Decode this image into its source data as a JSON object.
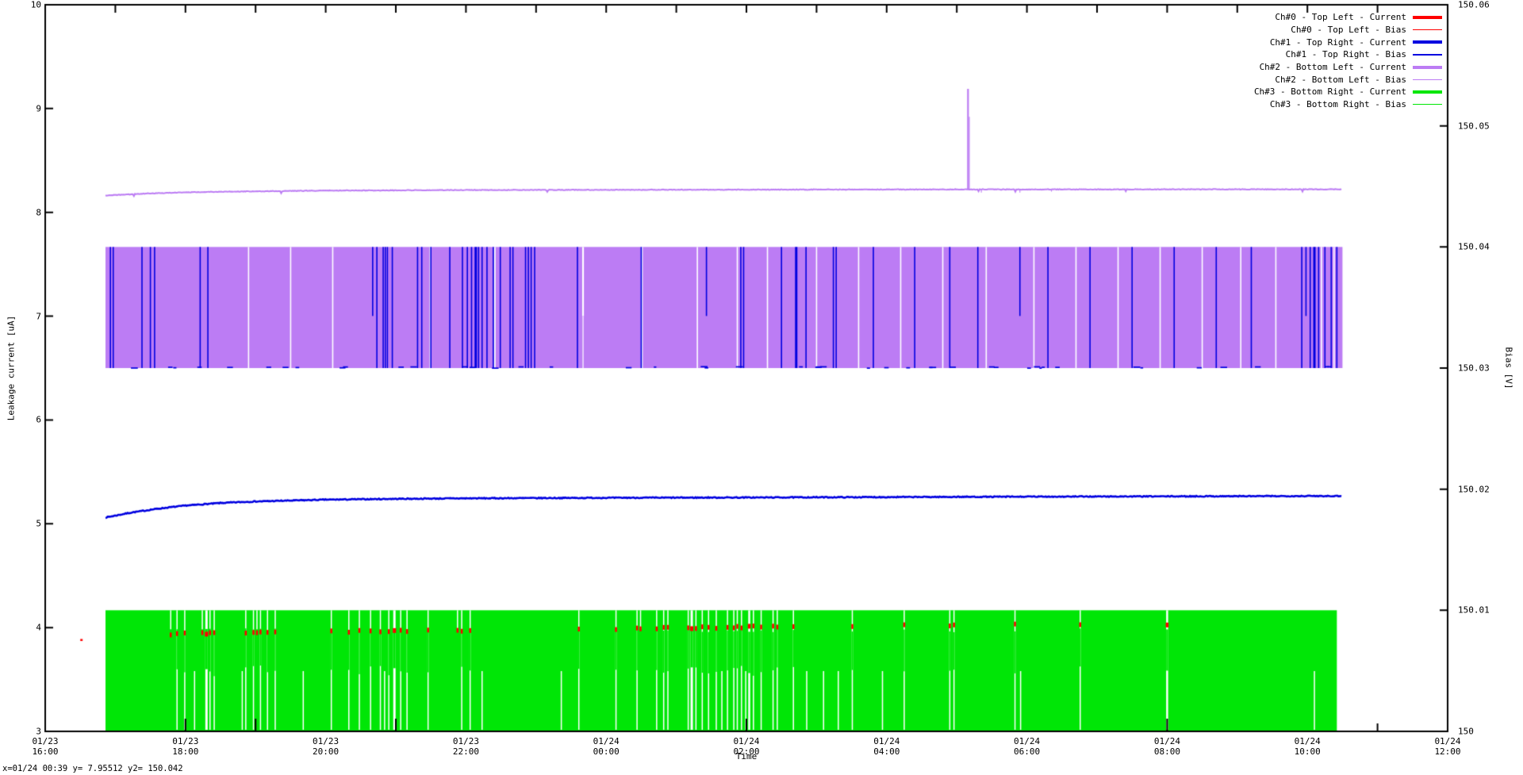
{
  "status_line": "x=01/24 00:39 y= 7.95512 y2= 150.042",
  "colors": {
    "red": "#ff0000",
    "blue": "#0000e0",
    "purple": "#bc7cf4",
    "green": "#00e606",
    "black": "#000000",
    "background": "#ffffff"
  },
  "legend": {
    "entries": [
      {
        "label": "Ch#0 - Top Left - Current",
        "color": "#ff0000",
        "thick": true
      },
      {
        "label": "Ch#0 - Top Left - Bias",
        "color": "#ff0000",
        "thick": false
      },
      {
        "label": "Ch#1 - Top Right - Current",
        "color": "#0000e0",
        "thick": true
      },
      {
        "label": "Ch#1 - Top Right - Bias",
        "color": "#0000e0",
        "thick": false
      },
      {
        "label": "Ch#2 - Bottom Left - Current",
        "color": "#bc7cf4",
        "thick": true
      },
      {
        "label": "Ch#2 - Bottom Left - Bias",
        "color": "#bc7cf4",
        "thick": false
      },
      {
        "label": "Ch#3 - Bottom Right - Current",
        "color": "#00e606",
        "thick": true
      },
      {
        "label": "Ch#3 - Bottom Right - Bias",
        "color": "#00e606",
        "thick": false
      }
    ]
  },
  "chart_data": {
    "type": "line",
    "title": "",
    "xlabel": "Time",
    "ylabel": "Leakage current [uA]",
    "y2label": "Bias [V]",
    "x_range": {
      "start": "01/23 16:00",
      "end": "01/24 12:00",
      "hours": 20
    },
    "ylim": [
      3,
      10
    ],
    "y2lim": [
      150.0,
      150.06
    ],
    "grid": false,
    "legend_position": "top-right-inside",
    "x_ticks": [
      {
        "date": "01/23",
        "time": "16:00"
      },
      {
        "date": "01/23",
        "time": "18:00"
      },
      {
        "date": "01/23",
        "time": "20:00"
      },
      {
        "date": "01/23",
        "time": "22:00"
      },
      {
        "date": "01/24",
        "time": "00:00"
      },
      {
        "date": "01/24",
        "time": "02:00"
      },
      {
        "date": "01/24",
        "time": "04:00"
      },
      {
        "date": "01/24",
        "time": "06:00"
      },
      {
        "date": "01/24",
        "time": "08:00"
      },
      {
        "date": "01/24",
        "time": "10:00"
      },
      {
        "date": "01/24",
        "time": "12:00"
      }
    ],
    "y_ticks": [
      "3",
      "4",
      "5",
      "6",
      "7",
      "8",
      "9",
      "10"
    ],
    "y2_ticks": [
      "150",
      "150.01",
      "150.02",
      "150.03",
      "150.04",
      "150.05",
      "150.06"
    ],
    "minor_x_tick_every_hours": 1,
    "data_span_hours": [
      0.86,
      18.5
    ],
    "visible_bottom_tick_stub_hours": [
      2,
      3,
      5,
      10,
      16
    ],
    "stray_red_dash": {
      "hour": 0.5,
      "value": 3.89
    },
    "series": [
      {
        "name": "Ch#0 - Top Left - Current",
        "axis": "y",
        "width": "thick",
        "color": "#ff0000",
        "kind": "noisy-line-hidden-behind-band",
        "keypoints": [
          [
            0.86,
            3.93
          ],
          [
            4,
            3.96
          ],
          [
            8,
            3.99
          ],
          [
            12,
            4.02
          ],
          [
            16,
            4.03
          ],
          [
            18.5,
            4.04
          ]
        ],
        "noise": 0.02,
        "note": "visible only as short red dashes inside white gaps of the green bias band"
      },
      {
        "name": "Ch#0 - Top Left - Bias",
        "axis": "y2",
        "width": "thin",
        "color": "#ff0000",
        "kind": "quantized-hidden",
        "levels": [
          150.0,
          150.01
        ],
        "note": "fully hidden behind Ch#3 bias band"
      },
      {
        "name": "Ch#1 - Top Right - Current",
        "axis": "y",
        "width": "thick",
        "color": "#0000e0",
        "kind": "smooth-line",
        "keypoints": [
          [
            0.86,
            5.06
          ],
          [
            1.2,
            5.105
          ],
          [
            1.6,
            5.145
          ],
          [
            2,
            5.175
          ],
          [
            2.5,
            5.2
          ],
          [
            3,
            5.215
          ],
          [
            4,
            5.232
          ],
          [
            5,
            5.24
          ],
          [
            6,
            5.245
          ],
          [
            8,
            5.25
          ],
          [
            10,
            5.253
          ],
          [
            12,
            5.257
          ],
          [
            14,
            5.261
          ],
          [
            16,
            5.264
          ],
          [
            18.5,
            5.268
          ]
        ],
        "noise": 0.009
      },
      {
        "name": "Ch#1 - Top Right - Bias",
        "axis": "y2",
        "width": "thin",
        "color": "#0000e0",
        "kind": "quantized-toggle-lines",
        "levels": [
          150.03,
          150.04
        ],
        "toggle_hours": [
          0.93,
          0.97,
          1.38,
          1.5,
          1.56,
          2.21,
          2.32,
          4.67,
          4.73,
          4.82,
          4.85,
          4.88,
          4.95,
          5.31,
          5.37,
          5.5,
          5.77,
          5.95,
          6.02,
          6.08,
          6.14,
          6.18,
          6.23,
          6.3,
          6.39,
          6.49,
          6.63,
          6.67,
          6.85,
          6.89,
          6.93,
          6.98,
          7.59,
          8.5,
          9.43,
          9.92,
          9.96,
          10.5,
          10.71,
          10.85,
          11.24,
          11.28,
          11.81,
          12.4,
          12.9,
          13.3,
          13.9,
          14.3,
          14.9,
          15.5,
          16.1,
          16.7,
          17.2,
          17.92,
          17.98,
          18.04,
          18.1,
          18.16,
          18.25,
          18.34,
          18.42
        ],
        "partial_toggle_hours": [
          4.67,
          9.43,
          13.9,
          17.98
        ],
        "thick_toggle_hours": [
          6.14,
          10.71,
          18.1
        ],
        "bottom_dash_count": 46
      },
      {
        "name": "Ch#2 - Bottom Left - Current",
        "axis": "y",
        "width": "thick",
        "color": "#bc7cf4",
        "kind": "smooth-line-with-spike",
        "keypoints": [
          [
            0.86,
            8.163
          ],
          [
            1.5,
            8.183
          ],
          [
            2,
            8.193
          ],
          [
            3,
            8.203
          ],
          [
            4,
            8.21
          ],
          [
            6,
            8.215
          ],
          [
            9,
            8.218
          ],
          [
            13,
            8.221
          ],
          [
            18.5,
            8.222
          ]
        ],
        "noise": 0.006,
        "spike": {
          "hour": 13.16,
          "peak": 9.19,
          "shoulder": 8.92
        },
        "post_spike_dips": [
          [
            13.35,
            8.19
          ],
          [
            13.9,
            8.19
          ],
          [
            14.35,
            8.2
          ]
        ]
      },
      {
        "name": "Ch#2 - Bottom Left - Bias",
        "axis": "y2",
        "width": "thin",
        "color": "#bc7cf4",
        "kind": "quantized-band",
        "levels": [
          150.03,
          150.04
        ],
        "gaps": [
          [
            2.9,
            0
          ],
          [
            3.5,
            0
          ],
          [
            4.1,
            0
          ],
          [
            5.49,
            0
          ],
          [
            6.41,
            0,
            2.2
          ],
          [
            7.67,
            1,
            2.2
          ],
          [
            8.51,
            0,
            2.2
          ],
          [
            9.3,
            0
          ],
          [
            9.87,
            0
          ],
          [
            10.3,
            0
          ],
          [
            11.0,
            0
          ],
          [
            11.6,
            0
          ],
          [
            12.2,
            0
          ],
          [
            12.8,
            0
          ],
          [
            13.42,
            0
          ],
          [
            14.1,
            0
          ],
          [
            14.7,
            0
          ],
          [
            15.3,
            0
          ],
          [
            15.9,
            0
          ],
          [
            16.5,
            0
          ],
          [
            17.05,
            0
          ],
          [
            17.55,
            0
          ],
          [
            18.2,
            0
          ],
          [
            18.38,
            0
          ]
        ]
      },
      {
        "name": "Ch#3 - Bottom Right - Current",
        "axis": "y",
        "width": "thick",
        "color": "#00e606",
        "kind": "noisy-line-hidden-in-band",
        "keypoints": [
          [
            0.86,
            3.78
          ],
          [
            18.5,
            3.8
          ]
        ],
        "noise": 0.15,
        "note": "visible as green mid segments inside white gaps of the green bias band"
      },
      {
        "name": "Ch#3 - Bottom Right - Bias",
        "axis": "y2",
        "width": "thin",
        "color": "#00e606",
        "kind": "quantized-band",
        "levels": [
          150.0,
          150.01
        ],
        "end_hour": 18.42,
        "red_dash_in_gaps": true,
        "gaps": [
          [
            1.79,
            1
          ],
          [
            1.88,
            0
          ],
          [
            1.99,
            0
          ],
          [
            2.13,
            2
          ],
          [
            2.24,
            1
          ],
          [
            2.3,
            0,
            3
          ],
          [
            2.35,
            0
          ],
          [
            2.41,
            0
          ],
          [
            2.81,
            2
          ],
          [
            2.86,
            0
          ],
          [
            2.97,
            0
          ],
          [
            3.02,
            1
          ],
          [
            3.07,
            0
          ],
          [
            3.17,
            0
          ],
          [
            3.28,
            0
          ],
          [
            3.68,
            2
          ],
          [
            4.08,
            0
          ],
          [
            4.33,
            0
          ],
          [
            4.48,
            0
          ],
          [
            4.64,
            0
          ],
          [
            4.78,
            0
          ],
          [
            4.84,
            2
          ],
          [
            4.9,
            0
          ],
          [
            4.98,
            0,
            3
          ],
          [
            5.07,
            0
          ],
          [
            5.16,
            0
          ],
          [
            5.46,
            0
          ],
          [
            5.88,
            1
          ],
          [
            5.94,
            0
          ],
          [
            6.06,
            0
          ],
          [
            6.23,
            2
          ],
          [
            7.36,
            2
          ],
          [
            7.61,
            0
          ],
          [
            8.14,
            0
          ],
          [
            8.44,
            0
          ],
          [
            8.49,
            1
          ],
          [
            8.72,
            0
          ],
          [
            8.82,
            0
          ],
          [
            8.88,
            0
          ],
          [
            9.17,
            0
          ],
          [
            9.22,
            0,
            3
          ],
          [
            9.28,
            0
          ],
          [
            9.37,
            0
          ],
          [
            9.46,
            0
          ],
          [
            9.57,
            0
          ],
          [
            9.65,
            2
          ],
          [
            9.73,
            0
          ],
          [
            9.82,
            0
          ],
          [
            9.87,
            0
          ],
          [
            9.93,
            0
          ],
          [
            9.99,
            2
          ],
          [
            10.04,
            0,
            2.5
          ],
          [
            10.1,
            0
          ],
          [
            10.21,
            0
          ],
          [
            10.38,
            0
          ],
          [
            10.44,
            0
          ],
          [
            10.67,
            0
          ],
          [
            10.86,
            2
          ],
          [
            11.1,
            2
          ],
          [
            11.31,
            2
          ],
          [
            11.51,
            0
          ],
          [
            11.94,
            2
          ],
          [
            12.25,
            0
          ],
          [
            12.9,
            0
          ],
          [
            12.96,
            0
          ],
          [
            13.83,
            0
          ],
          [
            13.91,
            2
          ],
          [
            14.76,
            0
          ],
          [
            16.0,
            0,
            2.5
          ],
          [
            18.1,
            2
          ]
        ]
      }
    ]
  }
}
